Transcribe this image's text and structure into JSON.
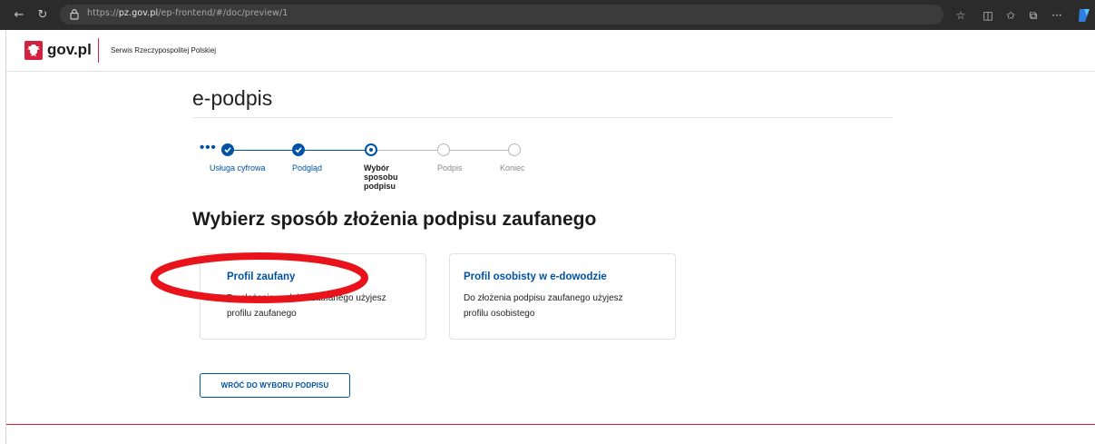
{
  "browser": {
    "url_prefix": "https://",
    "url_domain": "pz.gov.pl",
    "url_path": "/ep-frontend/#/doc/preview/1"
  },
  "header": {
    "logo_text": "gov.pl",
    "subtitle": "Serwis Rzeczypospolitej Polskiej"
  },
  "page": {
    "title": "e-podpis",
    "heading": "Wybierz sposób złożenia podpisu zaufanego"
  },
  "stepper": {
    "overflow": "•••",
    "steps": [
      {
        "label": "Usługa cyfrowa",
        "state": "done"
      },
      {
        "label": "Podgląd",
        "state": "done"
      },
      {
        "label": "Wybór sposobu podpisu",
        "state": "current"
      },
      {
        "label": "Podpis",
        "state": "todo"
      },
      {
        "label": "Koniec",
        "state": "todo"
      }
    ]
  },
  "cards": [
    {
      "title": "Profil zaufany",
      "description": "Do złożenia podpisu zaufanego użyjesz profilu zaufanego"
    },
    {
      "title": "Profil osobisty w e-dowodzie",
      "description": "Do złożenia podpisu zaufanego użyjesz profilu osobistego"
    }
  ],
  "actions": {
    "back_label": "WRÓĆ DO WYBORU PODPISU"
  },
  "colors": {
    "accent": "#0052a5",
    "brand_red": "#d4213d",
    "annotation": "#e8131b"
  }
}
